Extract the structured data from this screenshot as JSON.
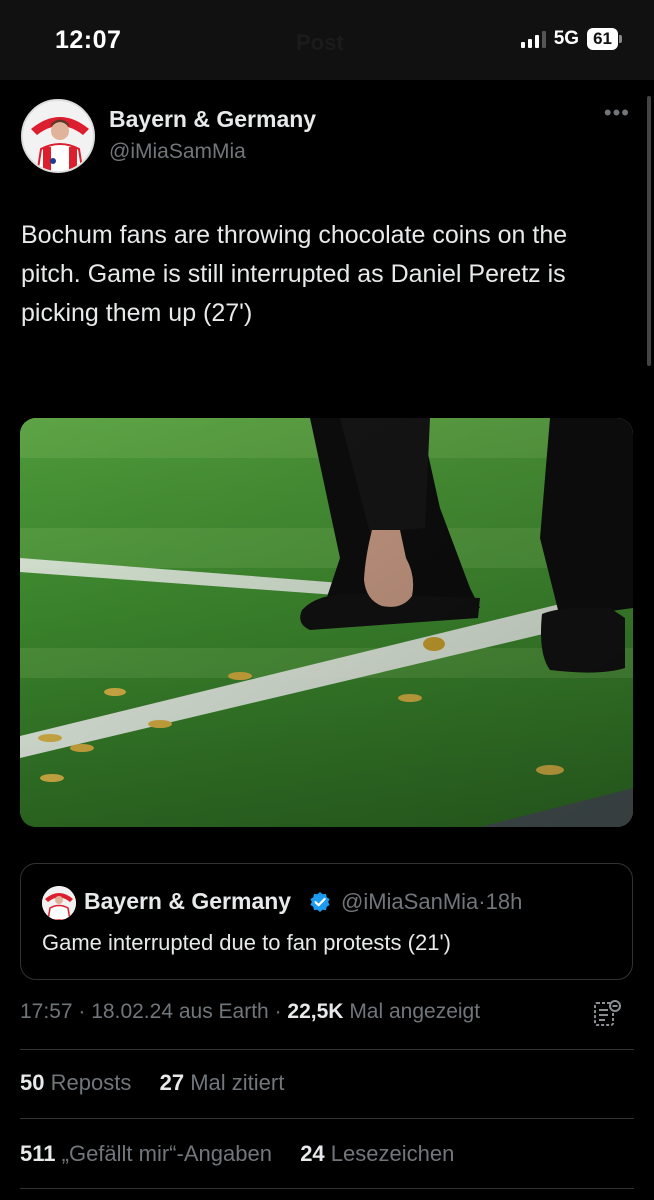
{
  "status_bar": {
    "time": "12:07",
    "ghost_title": "Post",
    "network": "5G",
    "battery": "61"
  },
  "author": {
    "name": "Bayern & Germany",
    "handle": "@iMiaSamMia"
  },
  "more_label": "•••",
  "tweet": {
    "text": "Bochum fans are throwing chocolate coins on the pitch. Game is still interrupted as Daniel Peretz is picking them up (27')"
  },
  "quote": {
    "name": "Bayern & Germany",
    "handle": "@iMiaSanMia",
    "sep": "·",
    "age": "18h",
    "text": "Game interrupted due to fan protests (21')"
  },
  "meta": {
    "time": "17:57",
    "sep1": "·",
    "date": "18.02.24",
    "source": "aus Earth",
    "sep2": "·",
    "views": "22,5K",
    "views_label": "Mal angezeigt"
  },
  "stats": {
    "reposts": "50",
    "reposts_label": "Reposts",
    "quotes": "27",
    "quotes_label": "Mal zitiert",
    "likes": "511",
    "likes_label": "„Gefällt mir“-Angaben",
    "bookmarks": "24",
    "bookmarks_label": "Lesezeichen"
  },
  "colors": {
    "background": "#000000",
    "text_primary": "#e7e9ea",
    "text_secondary": "#71767b",
    "border": "#2f3336",
    "verified_blue": "#1d9bf0"
  }
}
